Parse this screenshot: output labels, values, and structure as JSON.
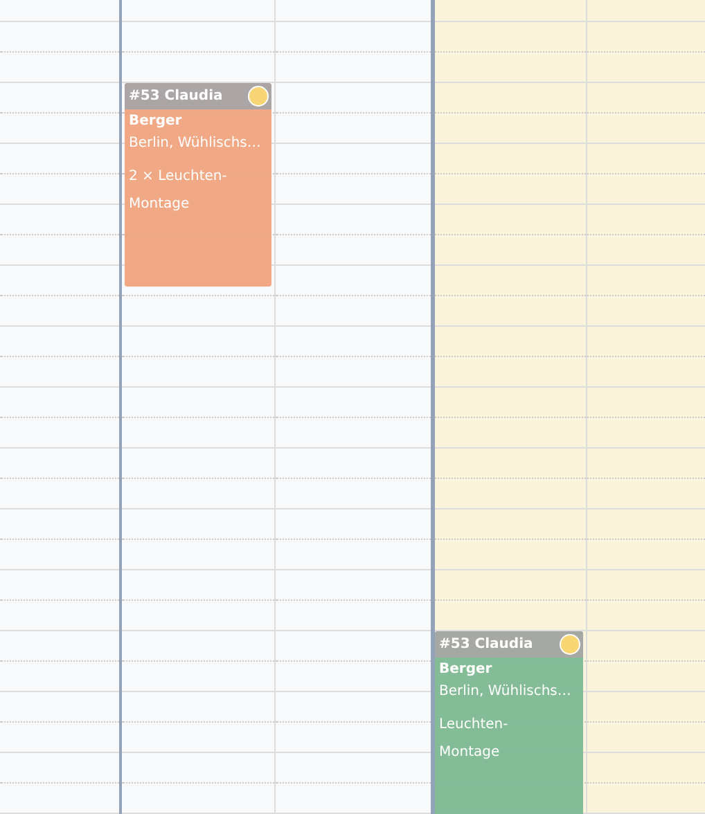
{
  "columns": [
    {
      "highlighted": false
    },
    {
      "highlighted": false,
      "events": [
        {
          "title": "#53 Claudia",
          "name": "Berger",
          "address": "Berlin, Wühlischs…",
          "description": "2 × Leuchten-Montage",
          "color": "#f0a27c",
          "status": {
            "color": "#f8d46a"
          }
        }
      ]
    },
    {
      "highlighted": false
    },
    {
      "highlighted": true,
      "events": [
        {
          "title": "#53 Claudia",
          "name": "Berger",
          "address": "Berlin, Wühlischs…",
          "description": "Leuchten-Montage",
          "color": "#7ab893",
          "status": {
            "color": "#f8d46a"
          }
        }
      ]
    },
    {
      "highlighted": true
    }
  ]
}
